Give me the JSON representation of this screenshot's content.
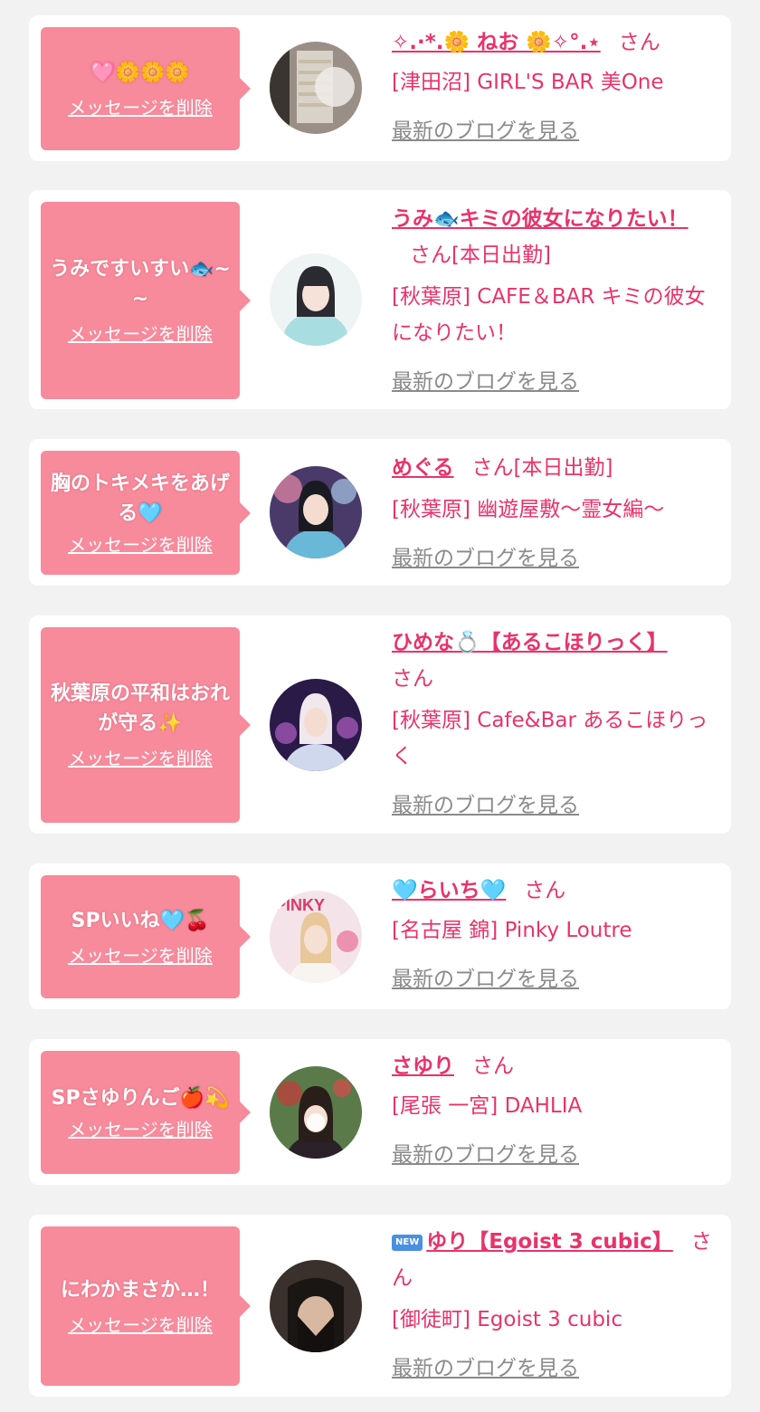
{
  "messages": [
    {
      "message": "🩷🌼🌼🌼",
      "delete_label": "メッセージを削除",
      "name": "✧.·*.🌼 ねお 🌼✧°.⋆",
      "honorific": "さん",
      "shop": "[津田沼] GIRL'S BAR 美One",
      "blog_label": "最新のブログを見る",
      "avatar_color": "#8a8078"
    },
    {
      "message": "うみですいすい🐟~~",
      "delete_label": "メッセージを削除",
      "name": "うみ🐟キミの彼女になりたい！",
      "honorific": "さん[本日出勤]",
      "shop": "[秋葉原] CAFE＆BAR キミの彼女になりたい！",
      "blog_label": "最新のブログを見る",
      "avatar_color": "#c9dde2"
    },
    {
      "message": "胸のトキメキをあげる🩵",
      "delete_label": "メッセージを削除",
      "name": "めぐる",
      "honorific": "さん[本日出勤]",
      "shop": "[秋葉原] 幽遊屋敷〜霊女編〜",
      "blog_label": "最新のブログを見る",
      "avatar_color": "#5a4a78"
    },
    {
      "message": "秋葉原の平和はおれが守る✨",
      "delete_label": "メッセージを削除",
      "name": "ひめな💍【あるこほりっく】",
      "honorific": "さん",
      "shop": "[秋葉原] Cafe&Bar あるこほりっく",
      "blog_label": "最新のブログを見る",
      "avatar_color": "#3a2a5a"
    },
    {
      "message": "SPいいね🩵🍒",
      "delete_label": "メッセージを削除",
      "name": "🩵らいち🩵",
      "honorific": "さん",
      "shop": "[名古屋 錦] Pinky Loutre",
      "blog_label": "最新のブログを見る",
      "avatar_color": "#e8c8d4"
    },
    {
      "message": "SPさゆりんご🍎💫",
      "delete_label": "メッセージを削除",
      "name": "さゆり",
      "honorific": "さん",
      "shop": "[尾張 一宮] DAHLIA",
      "blog_label": "最新のブログを見る",
      "avatar_color": "#6a4a3a"
    },
    {
      "message": "にわかまさか…！",
      "delete_label": "メッセージを削除",
      "badge": "NEW",
      "name": "ゆり【Egoist 3 cubic】",
      "honorific": "さん",
      "shop": "[御徒町] Egoist 3 cubic",
      "blog_label": "最新のブログを見る",
      "avatar_color": "#2a2220"
    }
  ]
}
